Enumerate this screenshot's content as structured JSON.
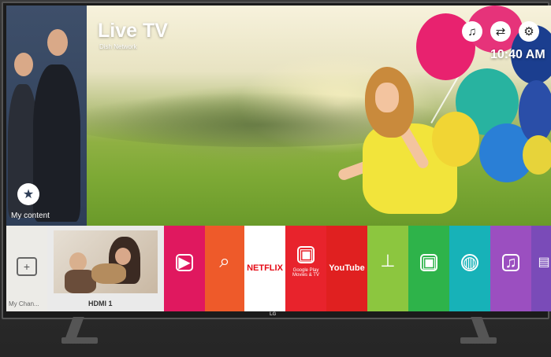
{
  "hero": {
    "title": "Live TV",
    "subtitle": "Dish Network",
    "clock": "10:40 AM"
  },
  "top_icons": [
    {
      "name": "music-icon",
      "glyph": "♫"
    },
    {
      "name": "input-icon",
      "glyph": "⇄"
    },
    {
      "name": "settings-gear-icon",
      "glyph": "⚙"
    }
  ],
  "left_tile": {
    "label": "My content",
    "icon_glyph": "★"
  },
  "launcher": {
    "my_channels_label": "My Chan...",
    "my_channels_glyph": "+",
    "hdmi_label": "HDMI 1",
    "apps": [
      {
        "name": "app-store",
        "glyph": "▶",
        "color": "#e0185f"
      },
      {
        "name": "search",
        "glyph": "○",
        "color": "#ee5a2a"
      },
      {
        "name": "netflix",
        "text": "NETFLIX",
        "color": "#ffffff",
        "text_color": "#e50914"
      },
      {
        "name": "google-play-movies",
        "text": "Google Play Movies & TV",
        "color": "#e8232c"
      },
      {
        "name": "youtube",
        "text": "YouTube",
        "color": "#e02020"
      },
      {
        "name": "antenna",
        "glyph": "⊥",
        "color": "#8cc63f"
      },
      {
        "name": "live-tv",
        "glyph": "▣",
        "color": "#2eb34a"
      },
      {
        "name": "internet",
        "glyph": "◍",
        "color": "#17b2b8"
      },
      {
        "name": "music",
        "glyph": "♫",
        "color": "#9b4fc0"
      },
      {
        "name": "gallery",
        "glyph": "▤",
        "color": "#7a4bb8"
      }
    ]
  },
  "brand_logo": "LG"
}
